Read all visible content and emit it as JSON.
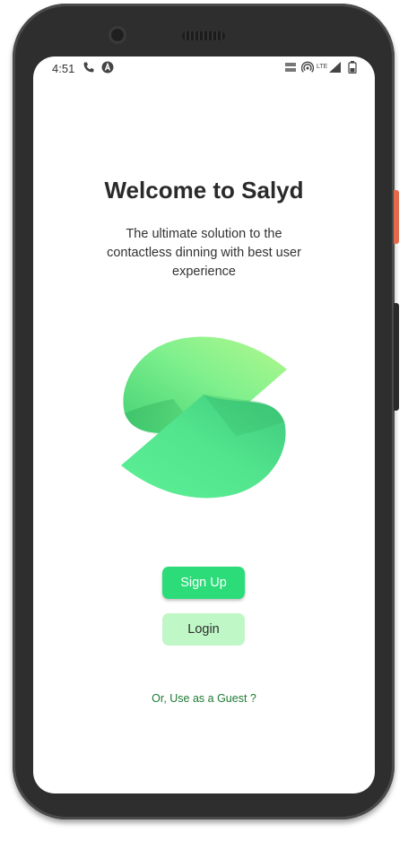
{
  "status_bar": {
    "time": "4:51",
    "icons": [
      "phone-icon",
      "a-icon",
      "wifi-lte-icon",
      "hotspot-icon",
      "lte-signal-icon",
      "battery-icon"
    ],
    "lte_label": "LTE"
  },
  "welcome": {
    "title": "Welcome to Salyd",
    "subtitle": "The ultimate solution to the contactless dinning with best user experience"
  },
  "logo": {
    "icon": "salyd-s-logo",
    "colors": [
      "#a6f58a",
      "#5ee88f",
      "#3ed47f"
    ]
  },
  "actions": {
    "signup_label": "Sign Up",
    "login_label": "Login",
    "guest_label": "Or, Use as a Guest ?"
  },
  "colors": {
    "primary": "#2bdc78",
    "secondary": "#bff7c6",
    "link": "#1d7a33"
  }
}
